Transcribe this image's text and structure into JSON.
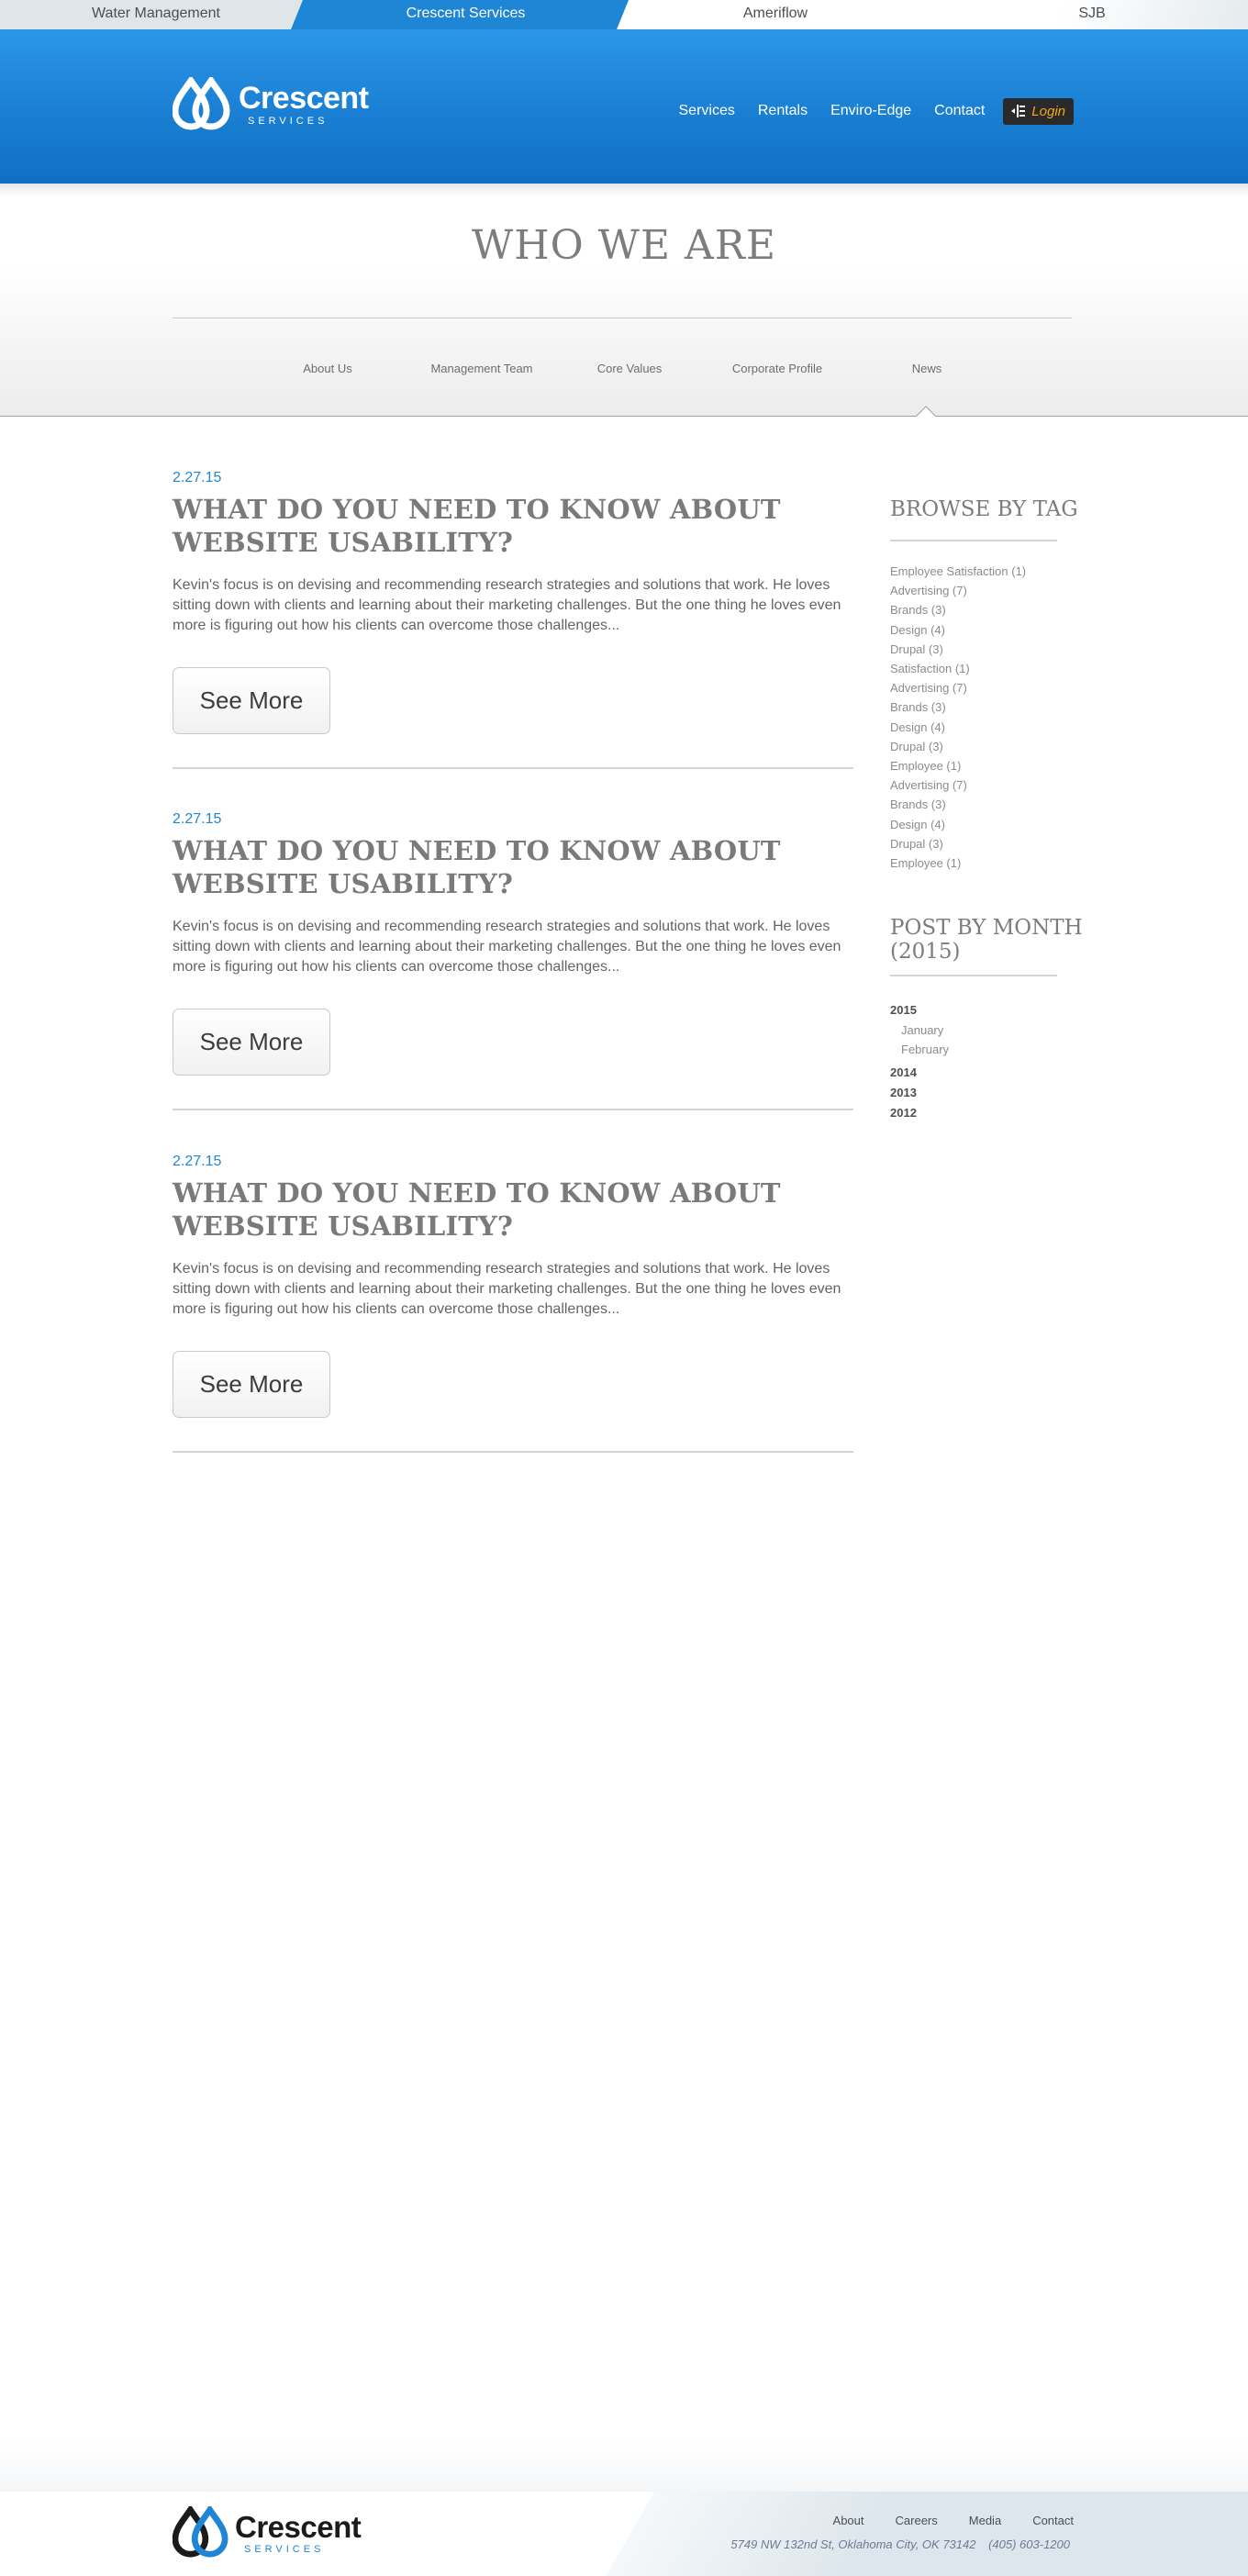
{
  "top_tabs": [
    {
      "label": "Water Management"
    },
    {
      "label": "Crescent Services"
    },
    {
      "label": "Ameriflow"
    },
    {
      "label": "SJB"
    }
  ],
  "header": {
    "logo_name": "Crescent",
    "logo_sub": "SERVICES",
    "nav": [
      {
        "label": "Services"
      },
      {
        "label": "Rentals"
      },
      {
        "label": "Enviro-Edge"
      },
      {
        "label": "Contact"
      }
    ],
    "login_label": "Login"
  },
  "band": {
    "title": "WHO WE ARE",
    "subnav": [
      {
        "label": "About Us"
      },
      {
        "label": "Management Team"
      },
      {
        "label": "Core Values"
      },
      {
        "label": "Corporate Profile"
      },
      {
        "label": "News"
      }
    ],
    "active_subnav": "News"
  },
  "posts": [
    {
      "date": "2.27.15",
      "title": "WHAT DO YOU NEED TO KNOW ABOUT WEBSITE USABILITY?",
      "body": "Kevin's focus is on devising and recommending research strategies and solutions that work. He loves sitting down with clients and learning about their marketing challenges. But the one thing he loves even more is figuring out how his clients can overcome those challenges...",
      "button": "See More"
    },
    {
      "date": "2.27.15",
      "title": "WHAT DO YOU NEED TO KNOW ABOUT WEBSITE USABILITY?",
      "body": "Kevin's focus is on devising and recommending research strategies and solutions that work. He loves sitting down with clients and learning about their marketing challenges. But the one thing he loves even more is figuring out how his clients can overcome those challenges...",
      "button": "See More"
    },
    {
      "date": "2.27.15",
      "title": "WHAT DO YOU NEED TO KNOW ABOUT WEBSITE USABILITY?",
      "body": "Kevin's focus is on devising and recommending research strategies and solutions that work. He loves sitting down with clients and learning about their marketing challenges. But the one thing he loves even more is figuring out how his clients can overcome those challenges...",
      "button": "See More"
    }
  ],
  "sidebar": {
    "tags_heading": "BROWSE BY TAG",
    "tags": [
      "Employee Satisfaction (1)",
      "Advertising (7)",
      "Brands (3)",
      "Design (4)",
      "Drupal (3)",
      "Satisfaction (1)",
      "Advertising (7)",
      "Brands (3)",
      "Design (4)",
      "Drupal (3)",
      "Employee (1)",
      "Advertising (7)",
      "Brands (3)",
      "Design (4)",
      "Drupal (3)",
      "Employee  (1)"
    ],
    "months_heading_1": "POST BY MONTH",
    "months_heading_2": "(2015)",
    "years": [
      {
        "year": "2015",
        "months": [
          "January",
          "February"
        ]
      },
      {
        "year": "2014",
        "months": []
      },
      {
        "year": "2013",
        "months": []
      },
      {
        "year": "2012",
        "months": []
      }
    ]
  },
  "footer": {
    "logo_name": "Crescent",
    "logo_sub": "SERVICES",
    "nav": [
      {
        "label": "About"
      },
      {
        "label": "Careers"
      },
      {
        "label": "Media"
      },
      {
        "label": "Contact"
      }
    ],
    "address": "5749 NW 132nd St, Oklahoma City, OK 73142",
    "phone": "(405) 603-1200"
  },
  "colors": {
    "brand_blue": "#1f86d6",
    "login_accent": "#f0a81c",
    "heading_grey": "#7a7a7a"
  }
}
